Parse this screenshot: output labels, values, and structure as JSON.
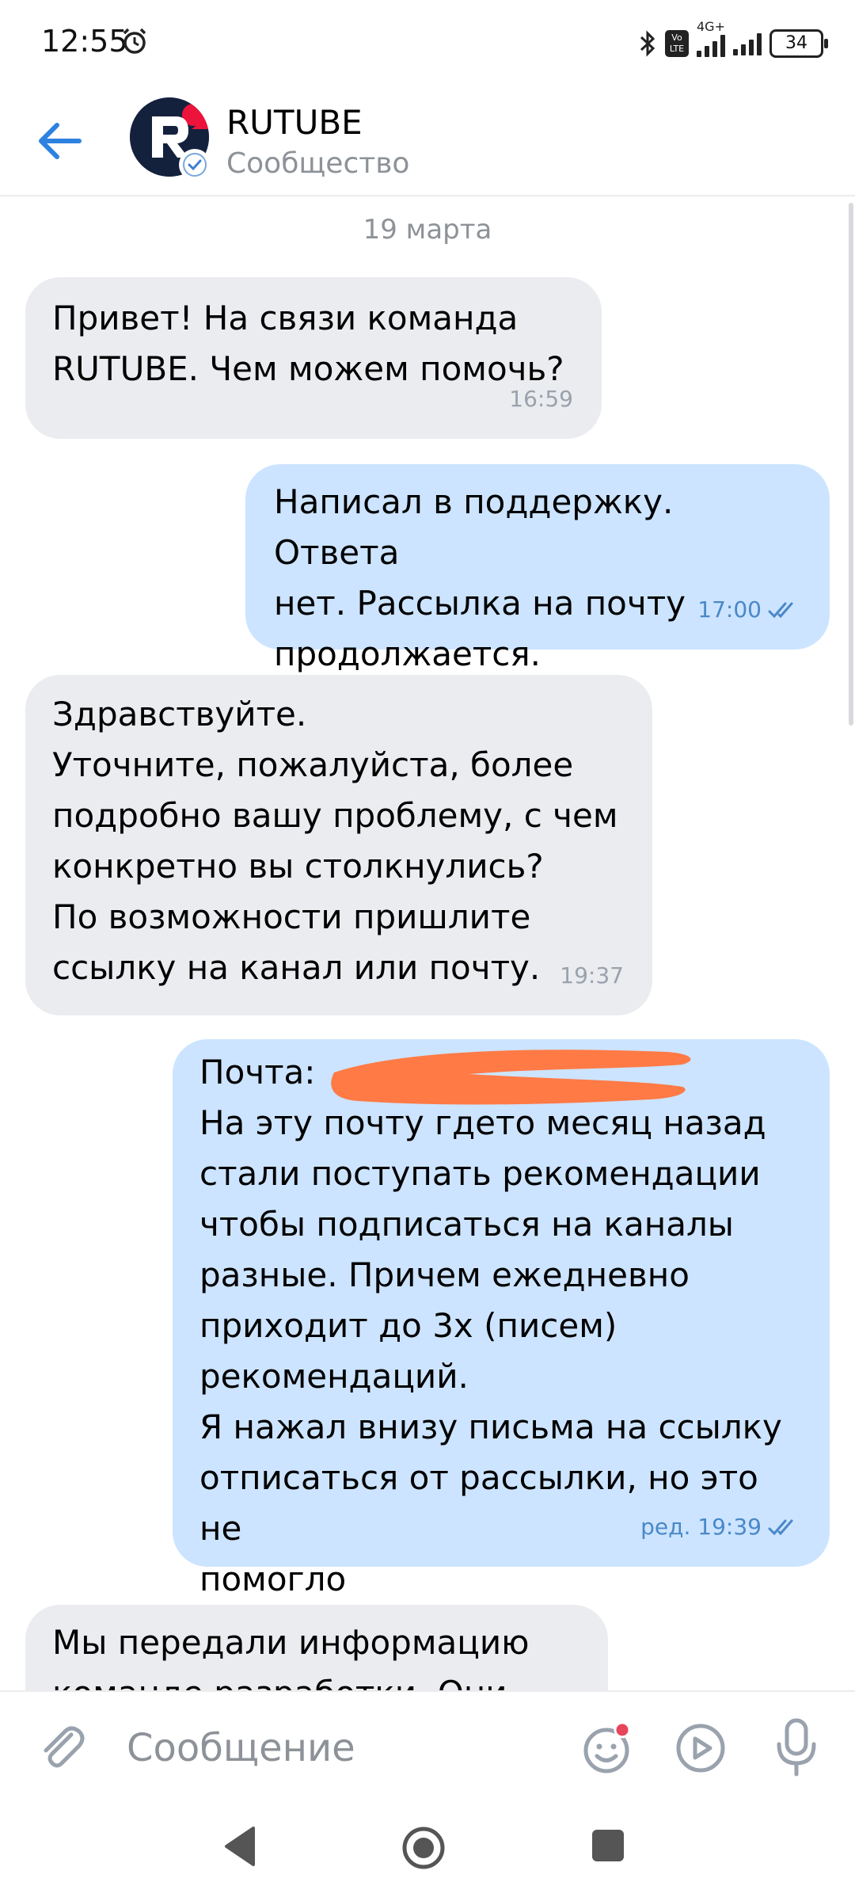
{
  "status_bar": {
    "time": "12:55",
    "network": "4G+",
    "battery": "34",
    "icons": [
      "alarm-icon",
      "bluetooth-icon",
      "volte-icon",
      "signal-icon",
      "battery-icon"
    ]
  },
  "header": {
    "title": "RUTUBE",
    "subtitle": "Сообщество",
    "avatar_letter": "R"
  },
  "chat": {
    "date": "19 марта",
    "messages": [
      {
        "direction": "incoming",
        "text": "Привет! На связи команда\nRUTUBE. Чем можем помочь?",
        "time": "16:59"
      },
      {
        "direction": "outgoing",
        "text": "Написал в поддержку. Ответа\nнет. Рассылка на почту\nпродолжается.",
        "time": "17:00",
        "read": true
      },
      {
        "direction": "incoming",
        "text": "Здравствуйте.\nУточните, пожалуйста, более\nподробно вашу проблему, с чем\nконкретно вы столкнулись?\nПо возможности пришлите\nссылку на канал или почту.",
        "time": "19:37"
      },
      {
        "direction": "outgoing",
        "text": "Почта:\nНа эту почту гдето месяц назад\nстали поступать рекомендации\nчтобы подписаться на каналы\nразные. Причем ежедневно\nприходит до 3х (писем)\nрекомендаций.\nЯ нажал внизу письма на ссылку\nотписаться от рассылки, но это не\nпомогло",
        "time": "ред. 19:39",
        "read": true
      },
      {
        "direction": "incoming",
        "text": "Мы передали информацию\nкоманде разработки. Они уже"
      }
    ]
  },
  "composer": {
    "placeholder": "Сообщение"
  },
  "colors": {
    "incoming_bubble": "#ebecef",
    "outgoing_bubble": "#cce4ff",
    "accent": "#2d81e0",
    "time_outgoing": "#4a88c8",
    "redaction": "#ff7a45"
  }
}
